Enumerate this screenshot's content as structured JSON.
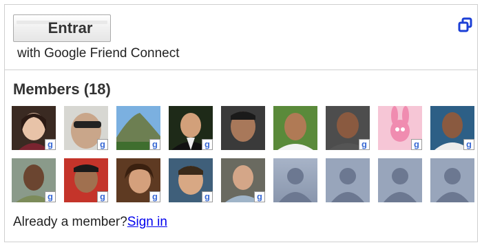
{
  "header": {
    "signin_button_label": "Entrar",
    "subtitle": "with Google Friend Connect",
    "popout_icon": "popout-window-icon"
  },
  "members": {
    "title": "Members (18)",
    "avatars": [
      {
        "kind": "photo",
        "badge": true,
        "icon": "member-avatar"
      },
      {
        "kind": "photo",
        "badge": true,
        "icon": "member-avatar"
      },
      {
        "kind": "photo",
        "badge": true,
        "icon": "member-avatar"
      },
      {
        "kind": "photo",
        "badge": true,
        "icon": "member-avatar"
      },
      {
        "kind": "photo",
        "badge": false,
        "icon": "member-avatar"
      },
      {
        "kind": "photo",
        "badge": false,
        "icon": "member-avatar"
      },
      {
        "kind": "photo",
        "badge": true,
        "icon": "member-avatar"
      },
      {
        "kind": "photo",
        "badge": true,
        "icon": "member-avatar"
      },
      {
        "kind": "photo",
        "badge": true,
        "icon": "member-avatar"
      },
      {
        "kind": "photo",
        "badge": true,
        "icon": "member-avatar"
      },
      {
        "kind": "photo",
        "badge": true,
        "icon": "member-avatar"
      },
      {
        "kind": "photo",
        "badge": true,
        "icon": "member-avatar"
      },
      {
        "kind": "photo",
        "badge": true,
        "icon": "member-avatar"
      },
      {
        "kind": "photo",
        "badge": true,
        "icon": "member-avatar"
      },
      {
        "kind": "placeholder",
        "badge": false,
        "icon": "default-avatar"
      },
      {
        "kind": "placeholder",
        "badge": false,
        "icon": "default-avatar"
      },
      {
        "kind": "placeholder",
        "badge": false,
        "icon": "default-avatar"
      },
      {
        "kind": "placeholder",
        "badge": false,
        "icon": "default-avatar"
      }
    ]
  },
  "footer": {
    "prompt": "Already a member?",
    "signin_link": "Sign in"
  },
  "colors": {
    "link": "#0000ee",
    "border": "#cfcfcf",
    "popout_icon": "#1b3fd6"
  }
}
